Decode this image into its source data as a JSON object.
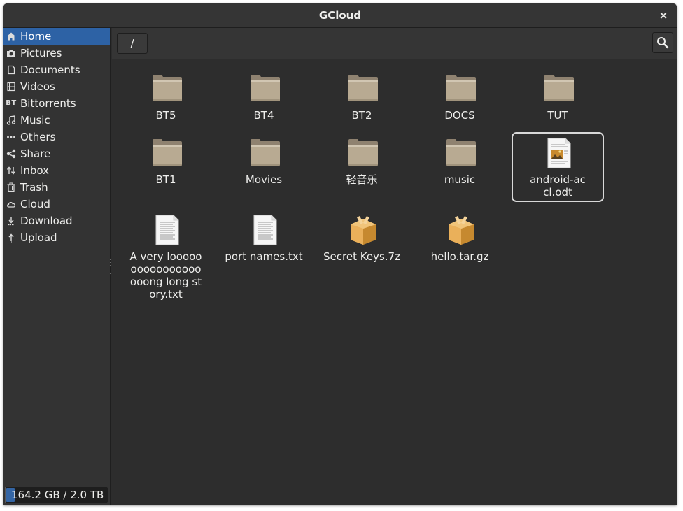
{
  "window": {
    "title": "GCloud"
  },
  "sidebar": {
    "items": [
      {
        "label": "Home",
        "icon": "home-icon",
        "active": true
      },
      {
        "label": "Pictures",
        "icon": "camera-icon"
      },
      {
        "label": "Documents",
        "icon": "document-icon"
      },
      {
        "label": "Videos",
        "icon": "film-icon"
      },
      {
        "label": "Bittorrents",
        "icon": "bittorrent-icon",
        "glyph": "BT"
      },
      {
        "label": "Music",
        "icon": "music-note-icon"
      },
      {
        "label": "Others",
        "icon": "more-dots-icon"
      },
      {
        "label": "Share",
        "icon": "share-icon"
      },
      {
        "label": "Inbox",
        "icon": "transfer-arrows-icon"
      },
      {
        "label": "Trash",
        "icon": "trash-icon"
      },
      {
        "label": "Cloud",
        "icon": "cloud-icon"
      },
      {
        "label": "Download",
        "icon": "download-icon"
      },
      {
        "label": "Upload",
        "icon": "upload-icon"
      }
    ],
    "storage": {
      "label": "164.2 GB / 2.0 TB",
      "used_fraction": 0.08
    }
  },
  "toolbar": {
    "path": "/",
    "search_icon": "search-icon"
  },
  "files": [
    {
      "name": "BT5",
      "type": "folder"
    },
    {
      "name": "BT4",
      "type": "folder"
    },
    {
      "name": "BT2",
      "type": "folder"
    },
    {
      "name": "DOCS",
      "type": "folder"
    },
    {
      "name": "TUT",
      "type": "folder"
    },
    {
      "name": "BT1",
      "type": "folder"
    },
    {
      "name": "Movies",
      "type": "folder"
    },
    {
      "name": "轻音乐",
      "type": "folder"
    },
    {
      "name": "music",
      "type": "folder"
    },
    {
      "name": "android-accl.odt",
      "type": "odt",
      "selected": true
    },
    {
      "name": "A very looooooooooooooooooong long story.txt",
      "type": "text"
    },
    {
      "name": "port names.txt",
      "type": "text"
    },
    {
      "name": "Secret Keys.7z",
      "type": "archive"
    },
    {
      "name": "hello.tar.gz",
      "type": "archive"
    }
  ],
  "colors": {
    "window_bg": "#2d2d2d",
    "selection": "#2d62a5",
    "folder": "#b8aa92",
    "archive": "#e2a349"
  }
}
